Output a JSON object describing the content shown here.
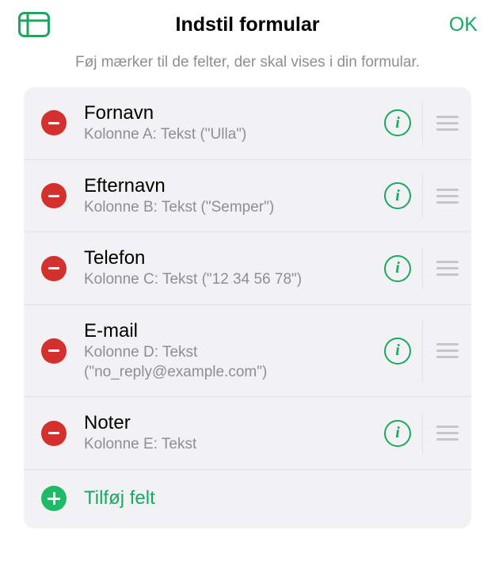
{
  "header": {
    "title": "Indstil formular",
    "ok_label": "OK"
  },
  "subtitle": "Føj mærker til de felter, der skal vises i din formular.",
  "fields": [
    {
      "title": "Fornavn",
      "subtitle": "Kolonne A: Tekst (\"Ulla\")"
    },
    {
      "title": "Efternavn",
      "subtitle": "Kolonne B: Tekst (\"Semper\")"
    },
    {
      "title": "Telefon",
      "subtitle": "Kolonne C: Tekst (\"12 34 56 78\")"
    },
    {
      "title": "E-mail",
      "subtitle": "Kolonne D: Tekst (\"no_reply@example.com\")"
    },
    {
      "title": "Noter",
      "subtitle": "Kolonne E: Tekst"
    }
  ],
  "add_field_label": "Tilføj felt",
  "info_glyph": "i"
}
